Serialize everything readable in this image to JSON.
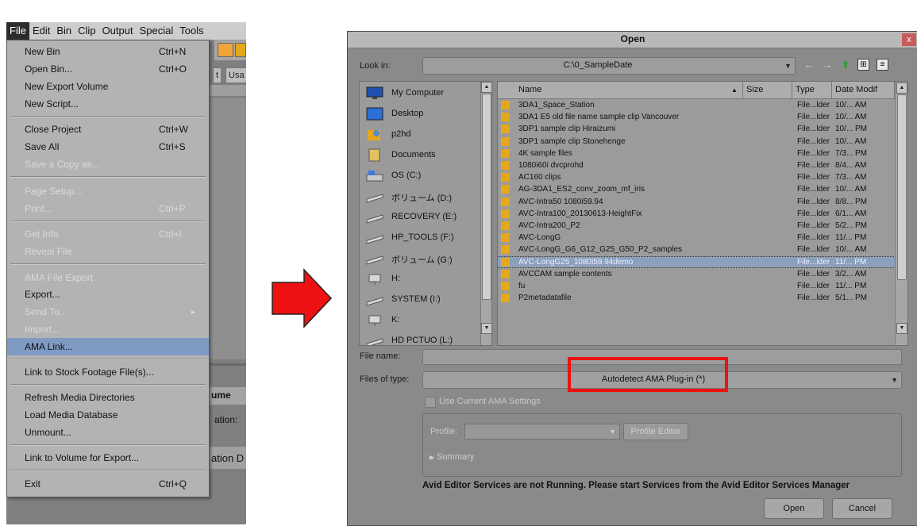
{
  "menu_bar": {
    "items": [
      "File",
      "Edit",
      "Bin",
      "Clip",
      "Output",
      "Special",
      "Tools"
    ]
  },
  "background": {
    "tab_t": "t",
    "tab_usa": "Usa",
    "label_ume": "ume",
    "label_ation": "ation:",
    "label_ation_d": "ation D"
  },
  "file_menu": {
    "items": [
      {
        "label": "New Bin",
        "shortcut": "Ctrl+N",
        "enabled": true
      },
      {
        "label": "Open Bin...",
        "shortcut": "Ctrl+O",
        "enabled": true
      },
      {
        "label": "New Export Volume",
        "shortcut": "",
        "enabled": true
      },
      {
        "label": "New Script...",
        "shortcut": "",
        "enabled": true
      },
      {
        "label": "Close Project",
        "shortcut": "Ctrl+W",
        "enabled": true
      },
      {
        "label": "Save All",
        "shortcut": "Ctrl+S",
        "enabled": true
      },
      {
        "label": "Save a Copy as...",
        "shortcut": "",
        "enabled": false
      },
      {
        "label": "Page Setup...",
        "shortcut": "",
        "enabled": false
      },
      {
        "label": "Print...",
        "shortcut": "Ctrl+P",
        "enabled": false
      },
      {
        "label": "Get Info",
        "shortcut": "Ctrl+I",
        "enabled": false
      },
      {
        "label": "Reveal File",
        "shortcut": "",
        "enabled": false
      },
      {
        "label": "AMA File Export",
        "shortcut": "",
        "enabled": false
      },
      {
        "label": "Export...",
        "shortcut": "",
        "enabled": true
      },
      {
        "label": "Send To...",
        "shortcut": "",
        "enabled": false
      },
      {
        "label": "Import...",
        "shortcut": "",
        "enabled": false
      },
      {
        "label": "AMA Link...",
        "shortcut": "",
        "enabled": true,
        "highlighted": true
      },
      {
        "label": "Link to Stock Footage File(s)...",
        "shortcut": "",
        "enabled": true
      },
      {
        "label": "Refresh Media Directories",
        "shortcut": "",
        "enabled": true
      },
      {
        "label": "Load Media Database",
        "shortcut": "",
        "enabled": true
      },
      {
        "label": "Unmount...",
        "shortcut": "",
        "enabled": true
      },
      {
        "label": "Link to Volume for Export...",
        "shortcut": "",
        "enabled": true
      },
      {
        "label": "Exit",
        "shortcut": "Ctrl+Q",
        "enabled": true
      }
    ]
  },
  "dialog": {
    "title": "Open",
    "close_glyph": "x",
    "look_in_label": "Look in:",
    "look_in_value": "C:\\0_SampleDate",
    "places": [
      "My Computer",
      "Desktop",
      "p2hd",
      "Documents",
      "OS (C:)",
      "ボリューム (D:)",
      "RECOVERY (E:)",
      "HP_TOOLS (F:)",
      "ボリューム (G:)",
      "H:",
      "SYSTEM (I:)",
      "K:",
      "HD PCTUO (L:)"
    ],
    "columns": {
      "name": "Name",
      "size": "Size",
      "type": "Type",
      "date": "Date Modif"
    },
    "files": [
      {
        "name": "3DA1_Space_Station",
        "type": "File...lder",
        "date": "10/... AM"
      },
      {
        "name": "3DA1 E5 old file name sample clip Vancouver",
        "type": "File...lder",
        "date": "10/... AM"
      },
      {
        "name": "3DP1 sample clip Hiraizumi",
        "type": "File...lder",
        "date": "10/... PM"
      },
      {
        "name": "3DP1 sample clip Stonehenge",
        "type": "File...lder",
        "date": "10/... AM"
      },
      {
        "name": "4K sample files",
        "type": "File...lder",
        "date": "7/3... PM"
      },
      {
        "name": "1080i60i dvcprohd",
        "type": "File...lder",
        "date": "8/4... AM"
      },
      {
        "name": "AC160 clips",
        "type": "File...lder",
        "date": "7/3... AM"
      },
      {
        "name": "AG-3DA1_ES2_conv_zoom_mf_iris",
        "type": "File...lder",
        "date": "10/... AM"
      },
      {
        "name": "AVC-Intra50 1080i59.94",
        "type": "File...lder",
        "date": "8/8... PM"
      },
      {
        "name": "AVC-Intra100_20130613-HeightFix",
        "type": "File...lder",
        "date": "6/1... AM"
      },
      {
        "name": "AVC-Intra200_P2",
        "type": "File...lder",
        "date": "5/2... PM"
      },
      {
        "name": "AVC-LongG",
        "type": "File...lder",
        "date": "11/... PM"
      },
      {
        "name": "AVC-LongG_G6_G12_G25_G50_P2_samples",
        "type": "File...lder",
        "date": "10/... AM"
      },
      {
        "name": "AVC-LongG25_1080i59.94demo",
        "type": "File...lder",
        "date": "11/... PM",
        "selected": true
      },
      {
        "name": "AVCCAM sample contents",
        "type": "File...lder",
        "date": "3/2... AM"
      },
      {
        "name": "fu",
        "type": "File...lder",
        "date": "11/... PM"
      },
      {
        "name": "P2metadatafile",
        "type": "File...lder",
        "date": "5/1... PM"
      }
    ],
    "file_name_label": "File name:",
    "file_name_value": "",
    "files_of_type_label": "Files of type:",
    "files_of_type_value": "Autodetect AMA Plug-in (*)",
    "use_current_ama_label": "Use Current AMA Settings",
    "profile_label": "Profile:",
    "profile_editor_label": "Profile Editor",
    "summary_label": "Summary",
    "warning": "Avid Editor Services are not Running. Please start Services from the Avid Editor Services Manager",
    "open_label": "Open",
    "cancel_label": "Cancel"
  },
  "colors": {
    "highlight": "#7f9bc4",
    "callout_red": "#ee1111",
    "arrow_red": "#ee1111",
    "folder": "#e4a81a"
  }
}
